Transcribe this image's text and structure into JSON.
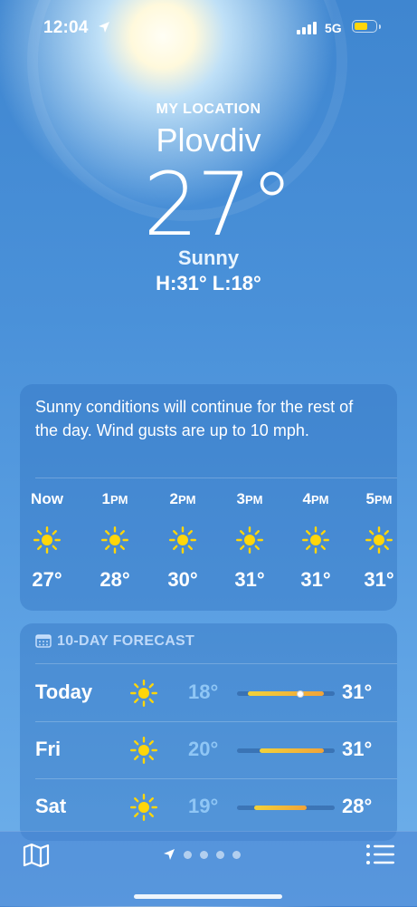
{
  "status_bar": {
    "time": "12:04",
    "network": "5G",
    "battery_color": "#ffd60a"
  },
  "header": {
    "my_location": "MY LOCATION",
    "city": "Plovdiv",
    "temperature": "27°",
    "condition": "Sunny",
    "high_low": "H:31°  L:18°"
  },
  "hourly": {
    "summary": "Sunny conditions will continue for the rest of the day. Wind gusts are up to 10 mph.",
    "hours": [
      {
        "num": "Now",
        "suffix": "",
        "icon": "sun-icon",
        "temp": "27°"
      },
      {
        "num": "1",
        "suffix": "PM",
        "icon": "sun-icon",
        "temp": "28°"
      },
      {
        "num": "2",
        "suffix": "PM",
        "icon": "sun-icon",
        "temp": "30°"
      },
      {
        "num": "3",
        "suffix": "PM",
        "icon": "sun-icon",
        "temp": "31°"
      },
      {
        "num": "4",
        "suffix": "PM",
        "icon": "sun-icon",
        "temp": "31°"
      },
      {
        "num": "5",
        "suffix": "PM",
        "icon": "sun-icon",
        "temp": "31°"
      }
    ]
  },
  "forecast": {
    "title": "10-DAY FORECAST",
    "days": [
      {
        "day": "Today",
        "icon": "sun-icon",
        "low": "18°",
        "high": "31°",
        "current_marker": true
      },
      {
        "day": "Fri",
        "icon": "sun-icon",
        "low": "20°",
        "high": "31°",
        "current_marker": false
      },
      {
        "day": "Sat",
        "icon": "sun-icon",
        "low": "19°",
        "high": "28°",
        "current_marker": false
      }
    ]
  },
  "bottom_bar": {
    "map_icon": "map-icon",
    "location_icon": "location-arrow-icon",
    "page_count": 4,
    "list_icon": "list-icon"
  }
}
